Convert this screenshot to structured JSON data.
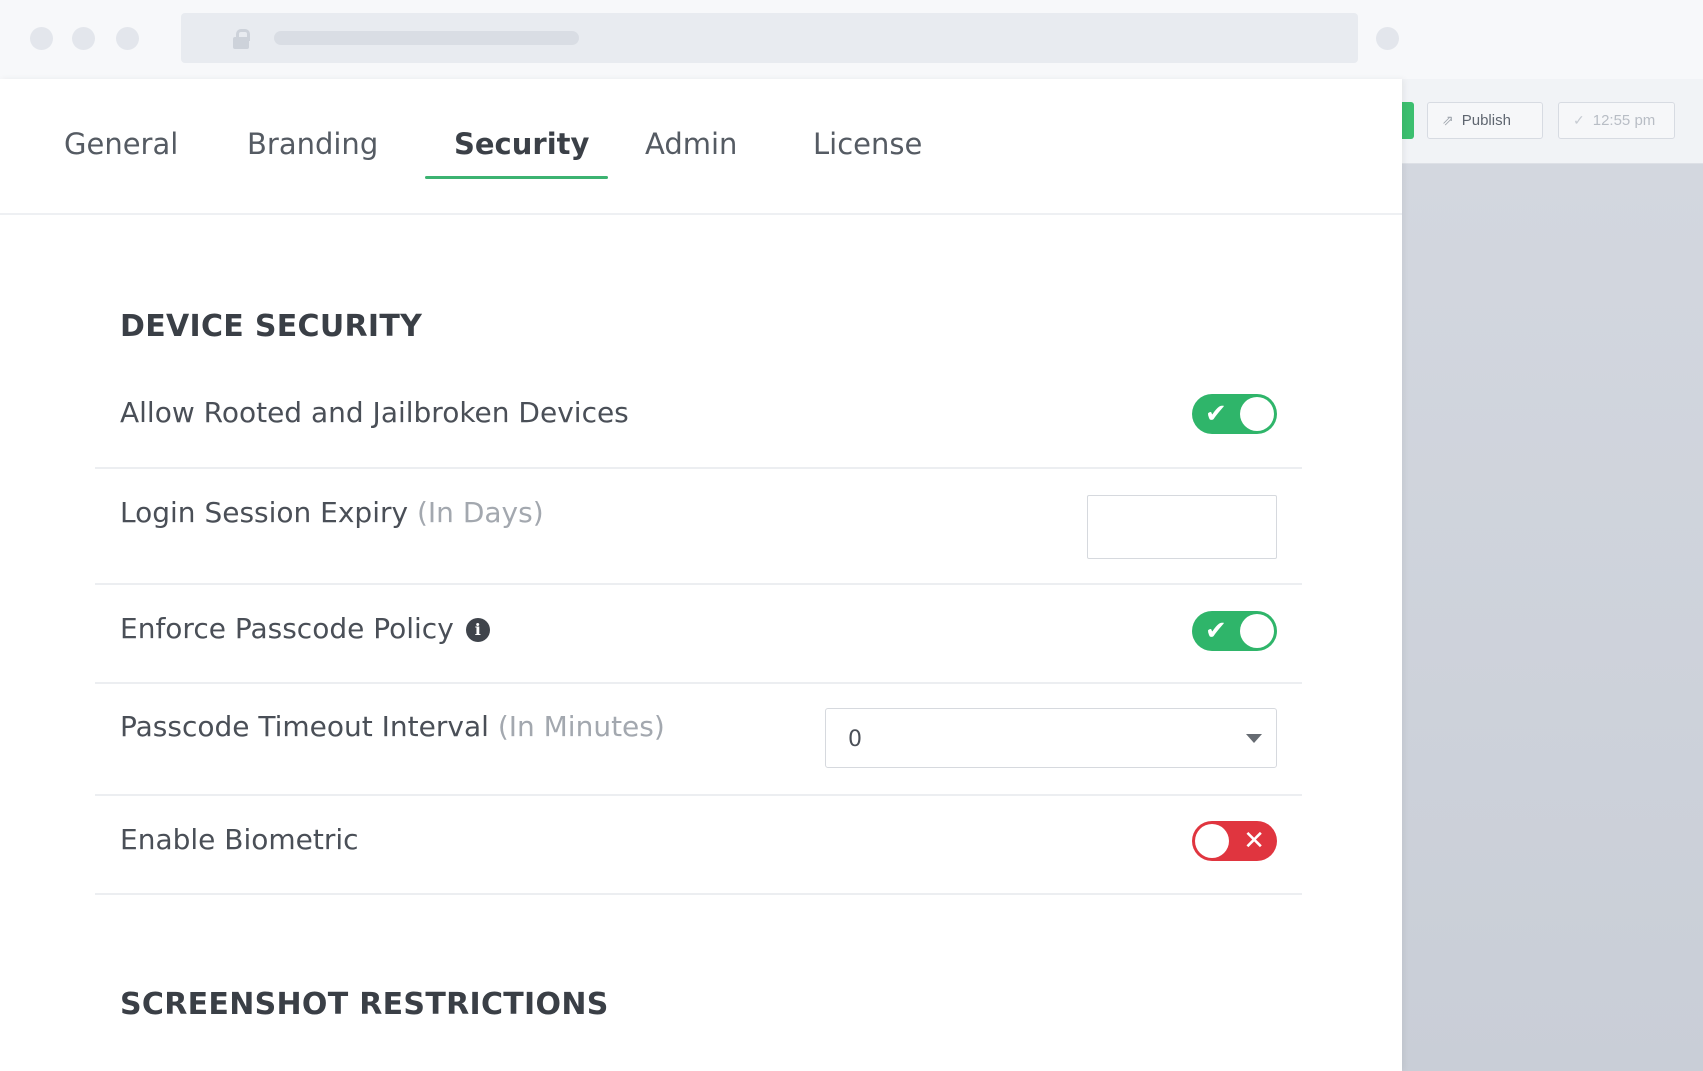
{
  "background_toolbar": {
    "publish_label": "Publish",
    "time_label": "12:55 pm"
  },
  "tabs": [
    {
      "label": "General"
    },
    {
      "label": "Branding"
    },
    {
      "label": "Security",
      "active": true
    },
    {
      "label": "Admin"
    },
    {
      "label": "License"
    }
  ],
  "device_security": {
    "title": "DEVICE SECURITY",
    "allow_rooted": {
      "label": "Allow Rooted and Jailbroken Devices",
      "enabled": true
    },
    "session_expiry": {
      "label": "Login Session Expiry",
      "hint": "(In Days)",
      "value": ""
    },
    "enforce_passcode": {
      "label": "Enforce Passcode Policy",
      "enabled": true
    },
    "passcode_timeout": {
      "label": "Passcode Timeout Interval",
      "hint": "(In Minutes)",
      "value": "0"
    },
    "biometric": {
      "label": "Enable Biometric",
      "enabled": false
    }
  },
  "screenshot_restrictions": {
    "title": "SCREENSHOT RESTRICTIONS"
  },
  "colors": {
    "accent": "#3cb371",
    "toggle_on": "#2fb56a",
    "toggle_off": "#e0353f"
  },
  "icons": {
    "toggle_on_mark": "✔",
    "toggle_off_mark": "✕",
    "info": "i",
    "publish": "share-icon",
    "time": "check-icon"
  }
}
